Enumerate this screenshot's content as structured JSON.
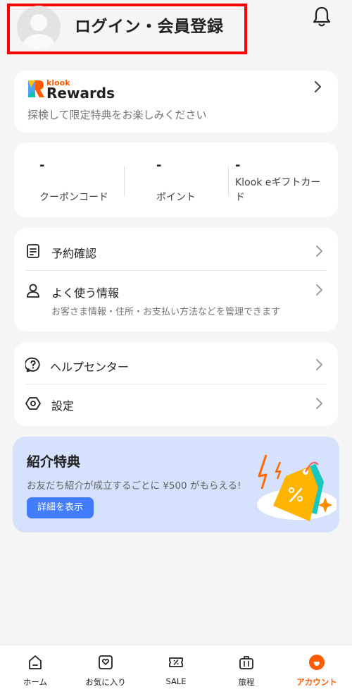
{
  "header": {
    "login_label": "ログイン・会員登録"
  },
  "rewards": {
    "brand_small": "klook",
    "brand": "Rewards",
    "subtitle": "探検して限定特典をお楽しみください"
  },
  "stats": [
    {
      "value": "-",
      "label": "クーポンコード"
    },
    {
      "value": "-",
      "label": "ポイント"
    },
    {
      "value": "-",
      "label": "Klook eギフトカード"
    }
  ],
  "menu_primary": [
    {
      "title": "予約確認",
      "icon": "document-icon"
    },
    {
      "title": "よく使う情報",
      "description": "お客さま情報・住所・お支払い方法などを管理できます",
      "icon": "person-icon"
    }
  ],
  "menu_secondary": [
    {
      "title": "ヘルプセンター",
      "icon": "help-icon"
    },
    {
      "title": "設定",
      "icon": "settings-icon"
    }
  ],
  "referral": {
    "title": "紹介特典",
    "description": "お友だち紹介が成立するごとに ¥500 がもらえる!",
    "button": "詳細を表示"
  },
  "tabbar": [
    {
      "label": "ホーム",
      "icon": "home-icon",
      "active": false
    },
    {
      "label": "お気に入り",
      "icon": "favorites-icon",
      "active": false
    },
    {
      "label": "SALE",
      "icon": "sale-icon",
      "active": false
    },
    {
      "label": "旅程",
      "icon": "suitcase-icon",
      "active": false
    },
    {
      "label": "アカウント",
      "icon": "account-icon",
      "active": true
    }
  ],
  "colors": {
    "accent": "#ff5b00",
    "highlight_border": "#ff0000",
    "referral_bg": "#d6e1fd",
    "button_blue": "#437dff"
  }
}
